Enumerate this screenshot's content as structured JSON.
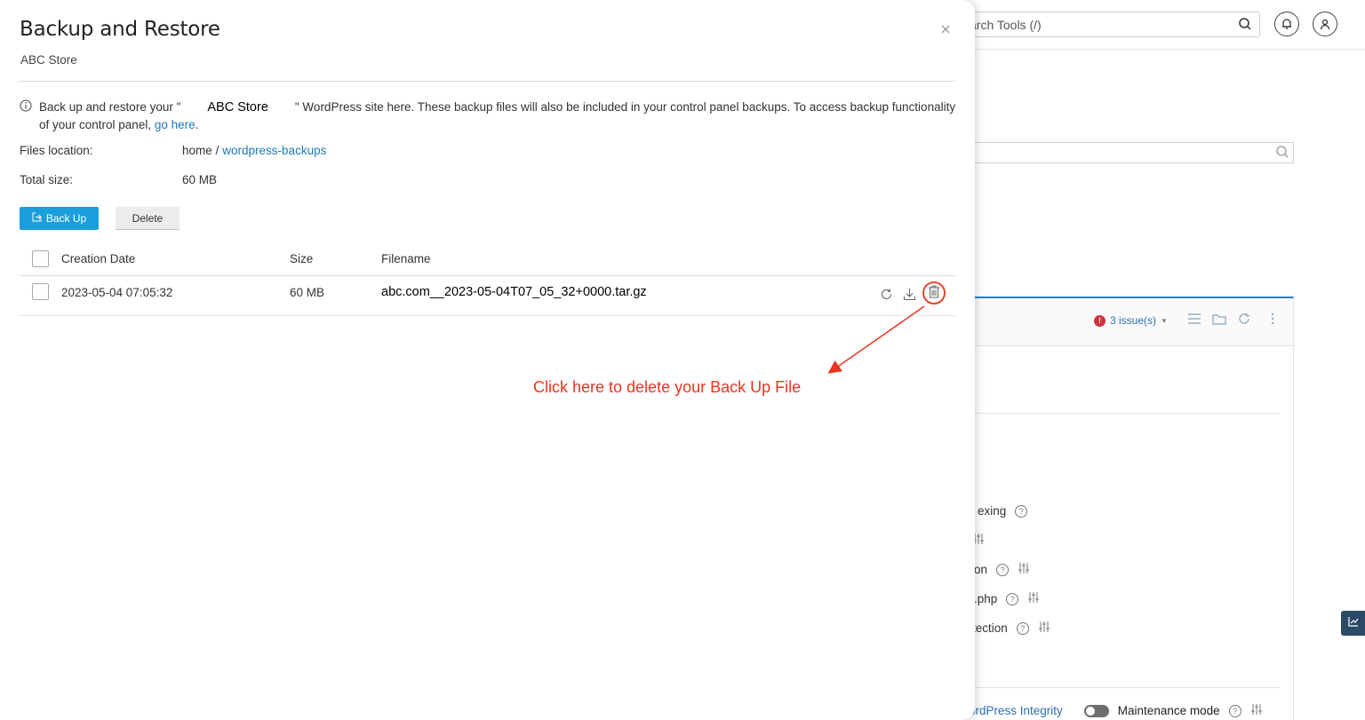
{
  "background": {
    "search_placeholder": "arch Tools (/)",
    "issues_label": "3 issue(s)",
    "issues_count": "!",
    "partial_items": [
      "exing",
      "on",
      ".php",
      "tection"
    ],
    "bottom_link": "ordPress Integrity",
    "maintenance_label": "Maintenance mode"
  },
  "modal": {
    "title": "Backup and Restore",
    "subtitle": "ABC Store",
    "info_before": "Back up and restore your \"",
    "info_site": "ABC Store",
    "info_after": "\" WordPress site here. These backup files will also be included in your control panel backups. To access backup functionality of your control panel,",
    "info_link": "go here",
    "info_end": ".",
    "files_location_label": "Files location:",
    "files_location_home": "home /",
    "files_location_folder": "wordpress-backups",
    "total_size_label": "Total size:",
    "total_size_value": "60 MB",
    "backup_button": "Back Up",
    "delete_button": "Delete"
  },
  "table": {
    "columns": [
      "Creation Date",
      "Size",
      "Filename"
    ],
    "rows": [
      {
        "date": "2023-05-04 07:05:32",
        "size": "60 MB",
        "filename": "abc.com__2023-05-04T07_05_32+0000.tar.gz"
      }
    ]
  },
  "annotation": {
    "text": "Click here to delete your Back Up File",
    "color": "#e8351f"
  },
  "colors": {
    "primary": "#1b9fdb",
    "link": "#1f7ab8",
    "accent_panel": "#2a7fbf",
    "issue_red": "#d0303b"
  }
}
